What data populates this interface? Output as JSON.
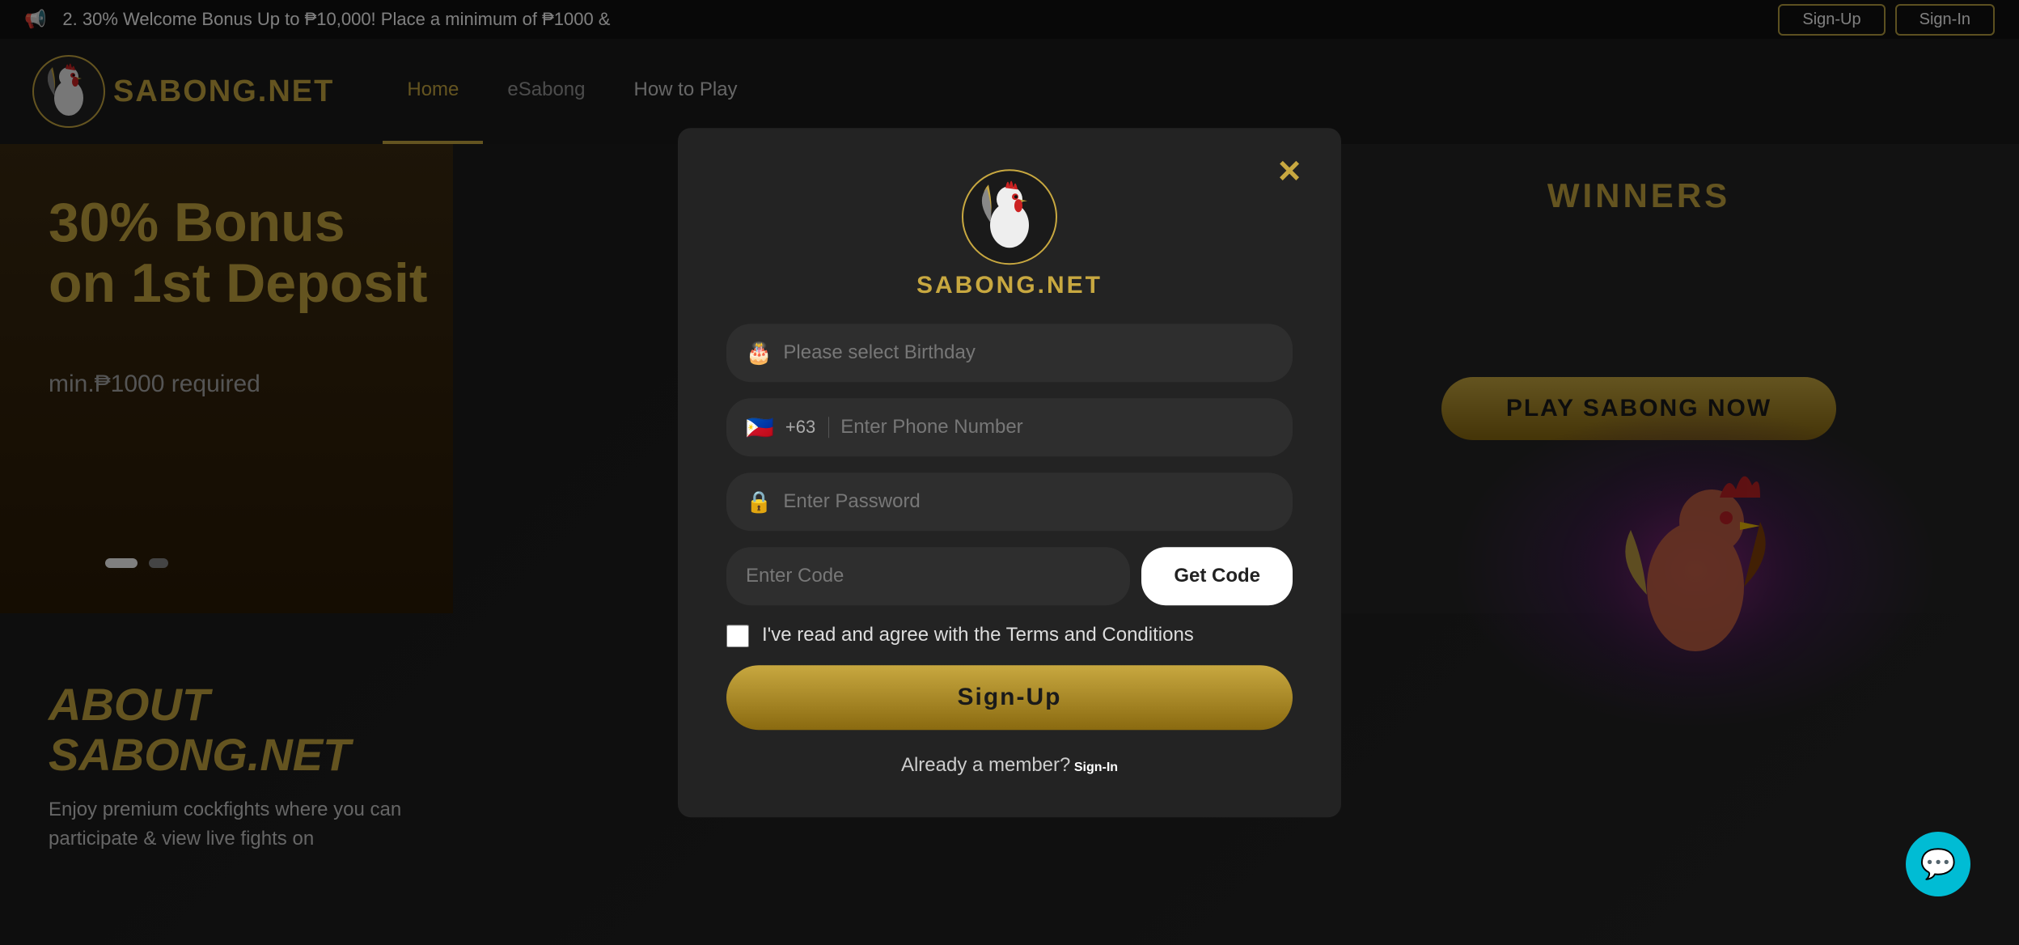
{
  "announcement": {
    "icon": "📢",
    "text": "2. 30% Welcome Bonus Up to ₱10,000! Place a minimum of ₱1000 &",
    "signup_btn": "Sign-Up",
    "signin_btn": "Sign-In"
  },
  "navbar": {
    "logo_text": "SABONG.NET",
    "links": [
      {
        "label": "Home",
        "active": true
      },
      {
        "label": "eSabong",
        "active": false
      },
      {
        "label": "How to Play",
        "active": false
      }
    ]
  },
  "banner": {
    "line1": "30% Bonus",
    "line2": "on 1st Deposit",
    "sub": "min.₱1000 required"
  },
  "winners": {
    "title": "WINNERS",
    "play_btn": "PLAY SABONG NOW"
  },
  "about": {
    "title": "ABOUT\nSABONG.NET",
    "text": "Enjoy premium cockfights where you\ncan participate & view live fights on"
  },
  "modal": {
    "logo_text": "SABONG.NET",
    "close_label": "×",
    "birthday_placeholder": "Please select Birthday",
    "phone_flag": "🇵🇭",
    "phone_code": "+63",
    "phone_placeholder": "Enter Phone Number",
    "password_placeholder": "Enter Password",
    "code_placeholder": "Enter Code",
    "get_code_btn": "Get Code",
    "terms_text": "I've read and agree with the Terms and Conditions",
    "signup_btn": "Sign-Up",
    "already_text": "Already a member?",
    "signin_link": "Sign-In"
  },
  "chat": {
    "icon": "💬"
  }
}
